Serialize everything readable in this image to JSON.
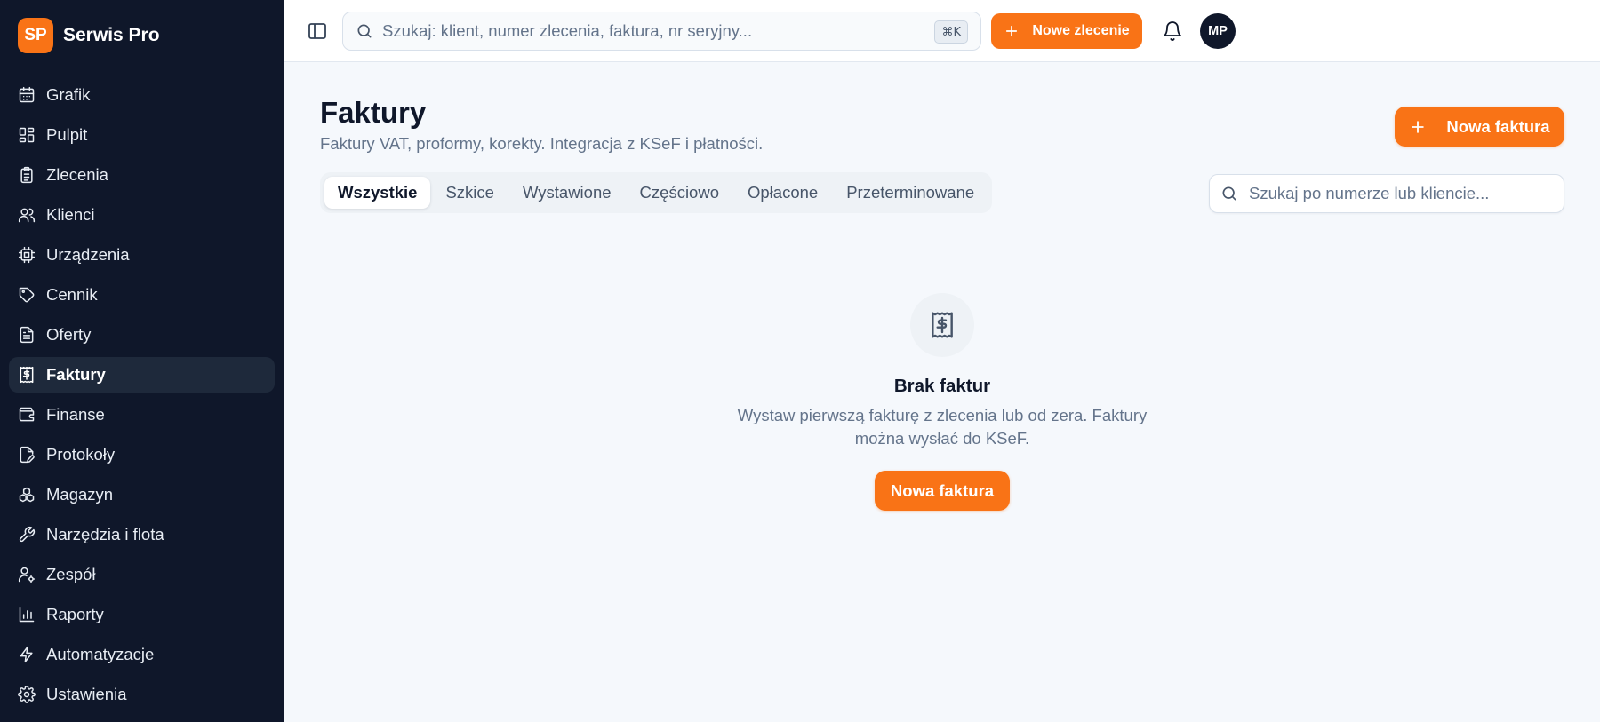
{
  "brand": {
    "logo": "SP",
    "name": "Serwis Pro"
  },
  "sidebar": {
    "items": [
      {
        "label": "Grafik",
        "icon": "calendar-icon"
      },
      {
        "label": "Pulpit",
        "icon": "dashboard-icon"
      },
      {
        "label": "Zlecenia",
        "icon": "clipboard-icon"
      },
      {
        "label": "Klienci",
        "icon": "users-icon"
      },
      {
        "label": "Urządzenia",
        "icon": "cpu-icon"
      },
      {
        "label": "Cennik",
        "icon": "tag-icon"
      },
      {
        "label": "Oferty",
        "icon": "document-icon"
      },
      {
        "label": "Faktury",
        "icon": "receipt-icon",
        "active": true
      },
      {
        "label": "Finanse",
        "icon": "wallet-icon"
      },
      {
        "label": "Protokoły",
        "icon": "edit-document-icon"
      },
      {
        "label": "Magazyn",
        "icon": "boxes-icon"
      },
      {
        "label": "Narzędzia i flota",
        "icon": "wrench-icon"
      },
      {
        "label": "Zespół",
        "icon": "user-cog-icon"
      },
      {
        "label": "Raporty",
        "icon": "bar-chart-icon"
      },
      {
        "label": "Automatyzacje",
        "icon": "lightning-icon"
      },
      {
        "label": "Ustawienia",
        "icon": "gear-icon"
      }
    ]
  },
  "topbar": {
    "search_placeholder": "Szukaj: klient, numer zlecenia, faktura, nr seryjny...",
    "shortcut": "⌘K",
    "new_order_label": "Nowe zlecenie",
    "avatar_initials": "MP"
  },
  "page": {
    "title": "Faktury",
    "subtitle": "Faktury VAT, proformy, korekty. Integracja z KSeF i płatności.",
    "new_invoice_label": "Nowa faktura"
  },
  "tabs": [
    {
      "label": "Wszystkie",
      "active": true
    },
    {
      "label": "Szkice"
    },
    {
      "label": "Wystawione"
    },
    {
      "label": "Częściowo"
    },
    {
      "label": "Opłacone"
    },
    {
      "label": "Przeterminowane"
    }
  ],
  "list_search": {
    "placeholder": "Szukaj po numerze lub kliencie..."
  },
  "empty_state": {
    "title": "Brak faktur",
    "text": "Wystaw pierwszą fakturę z zlecenia lub od zera. Faktury można wysłać do KSeF.",
    "button_label": "Nowa faktura"
  },
  "colors": {
    "accent": "#f97316",
    "sidebar_bg": "#0f172a",
    "page_bg": "#f5f8fc"
  }
}
